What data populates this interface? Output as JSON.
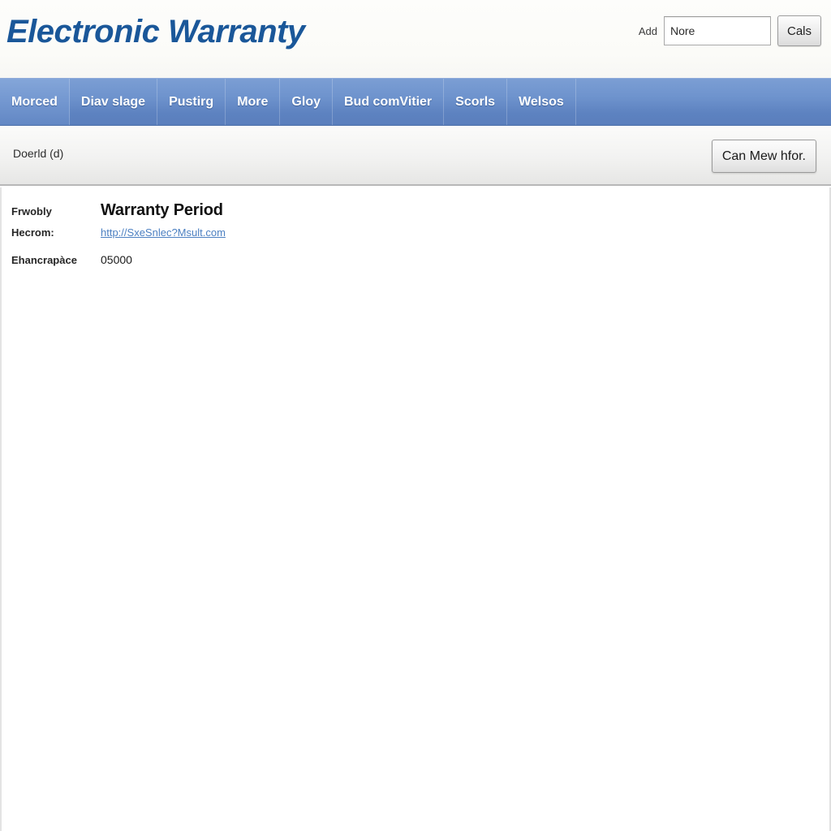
{
  "header": {
    "site_title": "Electronic Warranty",
    "add_label": "Add",
    "add_input_value": "Nore",
    "add_input_placeholder": "Nore",
    "cals_button_label": "Cals"
  },
  "nav": {
    "items": [
      {
        "label": "Morced",
        "active": true
      },
      {
        "label": "Diav slage",
        "active": false
      },
      {
        "label": "Pustirg",
        "active": false
      },
      {
        "label": "More",
        "active": false
      },
      {
        "label": "Gloy",
        "active": false
      },
      {
        "label": "Bud comVitier",
        "active": false
      },
      {
        "label": "Scorls",
        "active": false
      },
      {
        "label": "Welsos",
        "active": false
      }
    ]
  },
  "subheader": {
    "text": "Doerld (d)",
    "action_button_label": "Can Mew hfor."
  },
  "content": {
    "rows": [
      {
        "label": "Frwobly",
        "value": "Warranty Period",
        "style": "headline"
      },
      {
        "label": "Hecrom:",
        "value": "http://SxeSnlec?Msult.com",
        "style": "link"
      },
      {
        "label": "Ehancrapàce",
        "value": "05000",
        "style": "plain"
      }
    ]
  },
  "colors": {
    "title_blue": "#1a5799",
    "nav_blue": "#6e93cd",
    "nav_blue_dark": "#5a7fbd",
    "link_blue": "#2464b4",
    "subbar_gray": "#f2f2f1",
    "border_gray": "#b8b8b8"
  }
}
